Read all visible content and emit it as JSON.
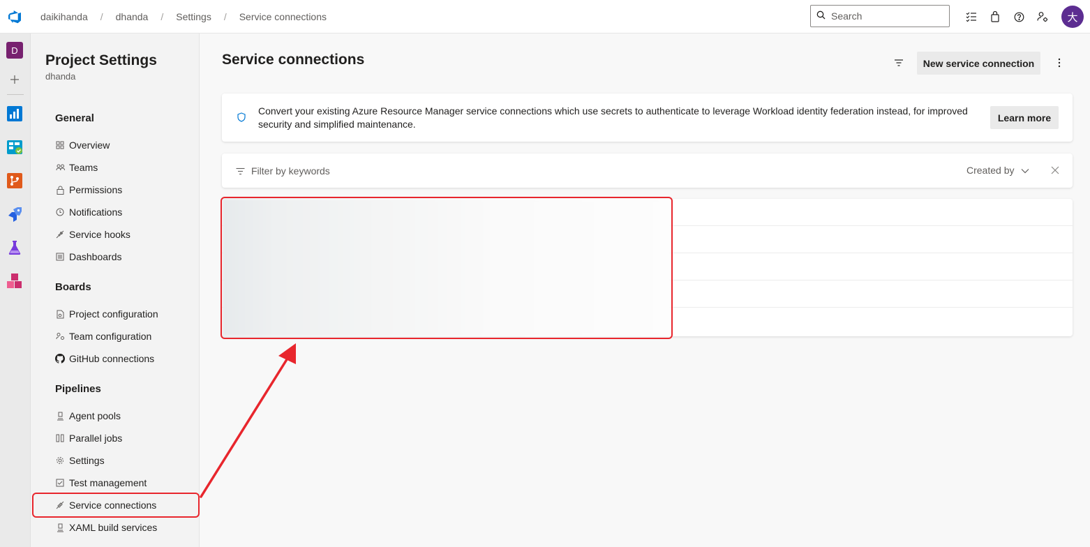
{
  "topbar": {
    "breadcrumbs": [
      "daikihanda",
      "dhanda",
      "Settings",
      "Service connections"
    ],
    "search_placeholder": "Search",
    "avatar_initial": "大",
    "icons": [
      "work-items-icon",
      "marketplace-icon",
      "help-icon",
      "user-settings-icon"
    ]
  },
  "rail": {
    "project_initial": "D",
    "items": [
      "overview-icon",
      "boards-icon",
      "repos-icon",
      "pipelines-icon",
      "test-plans-icon",
      "artifacts-icon"
    ]
  },
  "nav": {
    "title": "Project Settings",
    "subtitle": "dhanda",
    "sections": [
      {
        "label": "General",
        "items": [
          {
            "label": "Overview",
            "icon": "overview-icon"
          },
          {
            "label": "Teams",
            "icon": "teams-icon"
          },
          {
            "label": "Permissions",
            "icon": "lock-icon"
          },
          {
            "label": "Notifications",
            "icon": "notification-icon"
          },
          {
            "label": "Service hooks",
            "icon": "plug-icon"
          },
          {
            "label": "Dashboards",
            "icon": "dashboard-icon"
          }
        ]
      },
      {
        "label": "Boards",
        "items": [
          {
            "label": "Project configuration",
            "icon": "project-config-icon"
          },
          {
            "label": "Team configuration",
            "icon": "team-config-icon"
          },
          {
            "label": "GitHub connections",
            "icon": "github-icon"
          }
        ]
      },
      {
        "label": "Pipelines",
        "items": [
          {
            "label": "Agent pools",
            "icon": "agent-pool-icon"
          },
          {
            "label": "Parallel jobs",
            "icon": "parallel-jobs-icon"
          },
          {
            "label": "Settings",
            "icon": "gear-icon"
          },
          {
            "label": "Test management",
            "icon": "test-management-icon"
          },
          {
            "label": "Service connections",
            "icon": "plug-icon"
          },
          {
            "label": "XAML build services",
            "icon": "agent-pool-icon"
          }
        ]
      }
    ]
  },
  "main": {
    "title": "Service connections",
    "new_button": "New service connection",
    "banner": {
      "text": "Convert your existing Azure Resource Manager service connections which use secrets to authenticate to leverage Workload identity federation instead, for improved security and simplified maintenance.",
      "button": "Learn more"
    },
    "filter": {
      "placeholder": "Filter by keywords",
      "created_by": "Created by"
    },
    "row_count": 5
  },
  "colors": {
    "highlight": "#e8262d",
    "avatar": "#5c2d91",
    "project_badge": "#77216f",
    "azure_blue": "#0078d4"
  }
}
